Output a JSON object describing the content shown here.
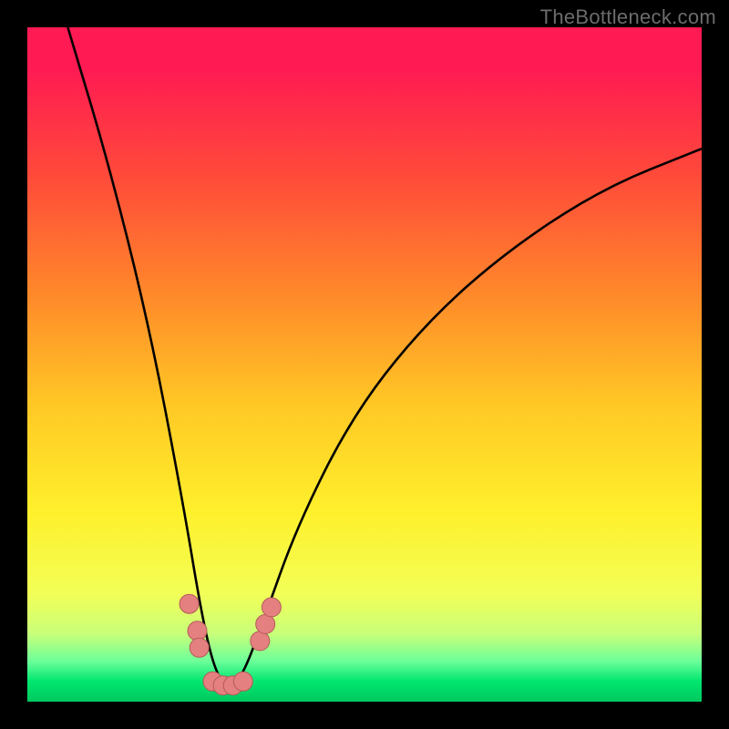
{
  "watermark": "TheBottleneck.com",
  "colors": {
    "background": "#000000",
    "curve_stroke": "#000000",
    "marker_fill": "#e58080",
    "marker_stroke": "#b35a5a"
  },
  "chart_data": {
    "type": "line",
    "title": "",
    "xlabel": "",
    "ylabel": "",
    "xlim": [
      0,
      100
    ],
    "ylim": [
      0,
      100
    ],
    "grid": false,
    "curve": {
      "description": "Bottleneck-style V curve with minimum near x≈29 plunging from top-left, rising toward upper-right",
      "points": [
        {
          "x": 6,
          "y": 100
        },
        {
          "x": 12,
          "y": 80
        },
        {
          "x": 18,
          "y": 56
        },
        {
          "x": 23,
          "y": 30
        },
        {
          "x": 26,
          "y": 12
        },
        {
          "x": 28,
          "y": 4
        },
        {
          "x": 30,
          "y": 2
        },
        {
          "x": 32,
          "y": 4
        },
        {
          "x": 35,
          "y": 12
        },
        {
          "x": 40,
          "y": 26
        },
        {
          "x": 48,
          "y": 42
        },
        {
          "x": 58,
          "y": 55
        },
        {
          "x": 70,
          "y": 66
        },
        {
          "x": 85,
          "y": 76
        },
        {
          "x": 100,
          "y": 82
        }
      ]
    },
    "series": [
      {
        "name": "left-cluster",
        "type": "scatter",
        "x": [
          24.0,
          25.2,
          25.5
        ],
        "y": [
          14.5,
          10.5,
          8.0
        ]
      },
      {
        "name": "bottom-cluster",
        "type": "scatter",
        "x": [
          27.5,
          29.0,
          30.5,
          32.0
        ],
        "y": [
          3.0,
          2.4,
          2.4,
          3.0
        ]
      },
      {
        "name": "right-cluster",
        "type": "scatter",
        "x": [
          34.5,
          35.3,
          36.2
        ],
        "y": [
          9.0,
          11.5,
          14.0
        ]
      }
    ]
  }
}
